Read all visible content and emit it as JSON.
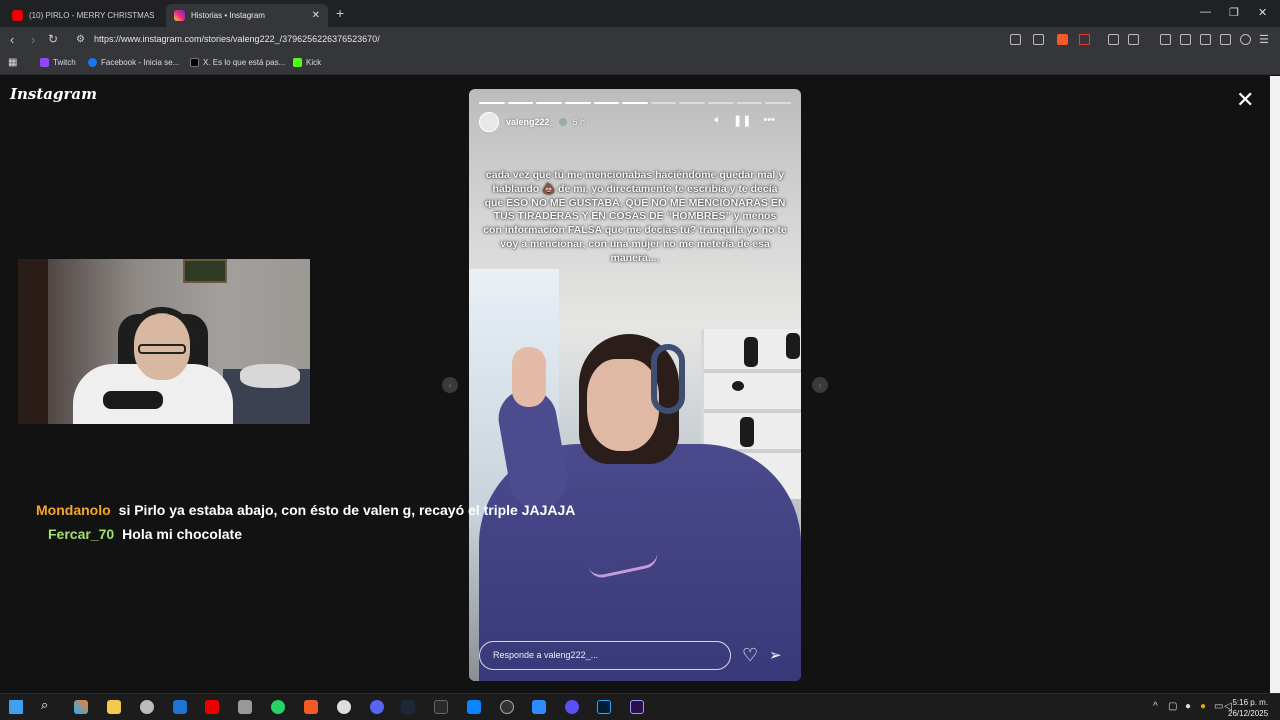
{
  "browser": {
    "tabs": [
      {
        "title": "(10) PIRLO - MERRY CHRISTMAS 1 (f",
        "favicon": "youtube-icon"
      },
      {
        "title": "Historias • Instagram",
        "favicon": "instagram-icon",
        "active": true
      }
    ],
    "new_tab": "+",
    "close_tab": "✕",
    "url": "https://www.instagram.com/stories/valeng222_/3796256226376523670/",
    "bookmarks": [
      {
        "label": "Twitch",
        "color": "#9146ff"
      },
      {
        "label": "Facebook - Inicia se...",
        "color": "#1877f2"
      },
      {
        "label": "X. Es lo que está pas...",
        "color": "#000000"
      },
      {
        "label": "Kick",
        "color": "#53fc18"
      }
    ]
  },
  "instagram": {
    "logo": "Instagram",
    "close": "✕",
    "story": {
      "username": "valeng222_",
      "time": "5 h",
      "caption": "cada vez que tú me mencionabas haciéndome quedar mal y hablando 💩 de mi, yo directamente te escribía y te decía que ESO NO ME GUSTABA, QUE NO ME MENCIONARAS EN TUS TIRADERAS Y EN COSAS DE “HOMBRES” y menos con información FALSA que me decías tú? tranquila yo no te voy a mencionar, con una mujer no me metería de esa manera....",
      "reply_placeholder": "Responde a valeng222_...",
      "segments_total": 11,
      "segments_done": 6
    }
  },
  "stream_chat": [
    {
      "user": "Mondanolo",
      "color": "#f5a623",
      "message": "si Pirlo ya estaba abajo, con ésto de valen g, recayó el triple JAJAJA"
    },
    {
      "user": "Fercar_70",
      "color": "#a3e06b",
      "message": "Hola mi chocolate"
    }
  ],
  "taskbar": {
    "time": "5:16 p. m.",
    "date": "26/12/2025"
  }
}
